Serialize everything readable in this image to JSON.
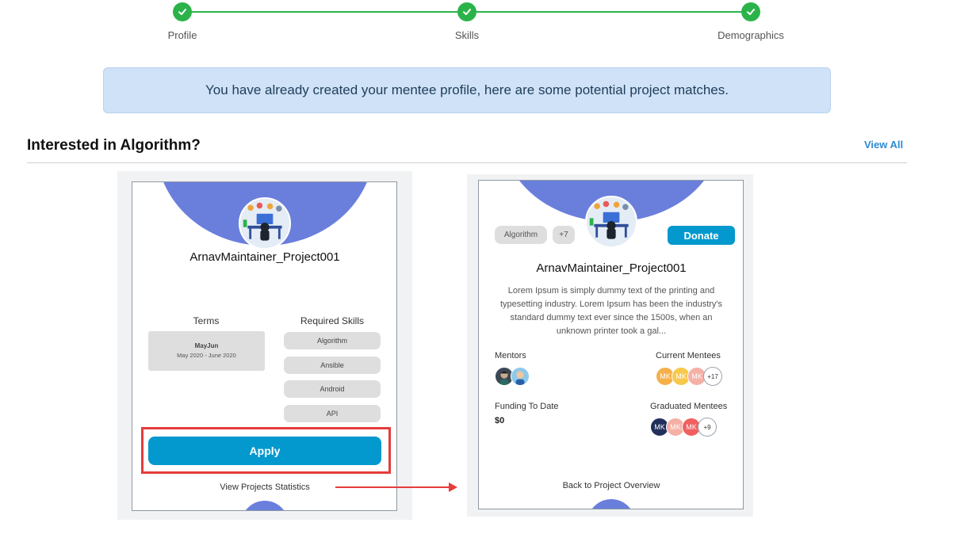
{
  "stepper": {
    "steps": [
      {
        "label": "Profile",
        "done": true
      },
      {
        "label": "Skills",
        "done": true
      },
      {
        "label": "Demographics",
        "done": true
      }
    ],
    "color": "#2bb34a"
  },
  "banner": {
    "text": "You have already created your mentee profile, here are some potential project matches."
  },
  "section": {
    "title": "Interested in Algorithm?",
    "view_all": "View All"
  },
  "card_overview": {
    "project_name": "ArnavMaintainer_Project001",
    "terms_title": "Terms",
    "terms": {
      "name": "MayJun",
      "dates": "May 2020 - June 2020"
    },
    "skills_title": "Required Skills",
    "skills": [
      "Algorithm",
      "Ansible",
      "Android",
      "API"
    ],
    "apply_label": "Apply",
    "stats_link": "View Projects Statistics"
  },
  "card_stats": {
    "tags": [
      "Algorithm",
      "+7"
    ],
    "donate_label": "Donate",
    "project_name": "ArnavMaintainer_Project001",
    "description": "Lorem Ipsum is simply dummy text of the printing and typesetting industry. Lorem Ipsum has been the industry's standard dummy text ever since the 1500s, when an unknown printer took a gal...",
    "mentors_label": "Mentors",
    "current_mentees_label": "Current Mentees",
    "current_mentees": [
      "MK",
      "MK",
      "MK"
    ],
    "current_mentees_more": "+17",
    "funding_label": "Funding To Date",
    "funding_value": "$0",
    "graduated_label": "Graduated Mentees",
    "graduated_mentees": [
      "MK",
      "MK",
      "MK"
    ],
    "graduated_more": "+9",
    "back_link": "Back to Project Overview"
  },
  "colors": {
    "accent_blue": "#0399ce",
    "header_purple": "#6a7fdc",
    "highlight_red": "#e63c3c",
    "banner_bg": "#cfe2f7"
  }
}
